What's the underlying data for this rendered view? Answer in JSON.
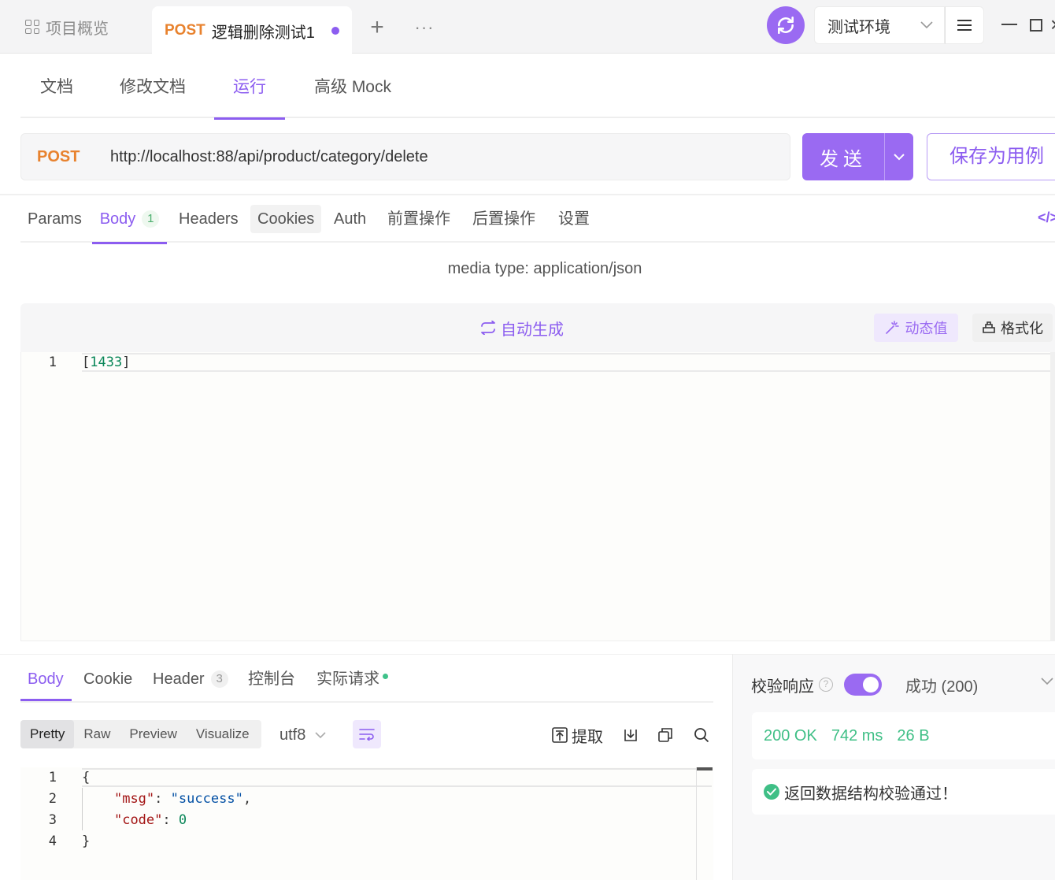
{
  "top_tabs": {
    "overview_label": "项目概览",
    "active_method": "POST",
    "active_title": "逻辑删除测试1",
    "plus": "+",
    "more": "···"
  },
  "environment": {
    "label": "测试环境"
  },
  "window_close": "×",
  "subnav": [
    "文档",
    "修改文档",
    "运行",
    "高级 Mock"
  ],
  "request": {
    "method": "POST",
    "url": "http://localhost:88/api/product/category/delete",
    "send_label": "发送",
    "save_label": "保存为用例"
  },
  "req_tabs": {
    "params": "Params",
    "body": "Body",
    "body_badge": "1",
    "headers": "Headers",
    "cookies": "Cookies",
    "auth": "Auth",
    "pre_ops": "前置操作",
    "post_ops": "后置操作",
    "settings": "设置",
    "code_toggle": "</>"
  },
  "body_editor": {
    "media_type": "media type: application/json",
    "auto_generate": "自动生成",
    "dynamic_value": "动态值",
    "format": "格式化",
    "line_no": "1",
    "value": "1433"
  },
  "response": {
    "tabs": {
      "body": "Body",
      "cookie": "Cookie",
      "header": "Header",
      "header_badge": "3",
      "console": "控制台",
      "actual_request": "实际请求"
    },
    "views": [
      "Pretty",
      "Raw",
      "Preview",
      "Visualize"
    ],
    "encoding": "utf8",
    "extract": "提取",
    "line_numbers": [
      "1",
      "2",
      "3",
      "4"
    ],
    "json": {
      "msg_key": "msg",
      "msg_value": "success",
      "code_key": "code",
      "code_value": "0"
    }
  },
  "validation": {
    "label": "校验响应",
    "help": "?",
    "result": "成功 (200)",
    "status": "200 OK",
    "time": "742 ms",
    "size": "26 B",
    "pass_message": "返回数据结构校验通过！"
  },
  "colors": {
    "accent": "#8c5df0",
    "method_post": "#e8822e",
    "success": "#3fbf86"
  }
}
